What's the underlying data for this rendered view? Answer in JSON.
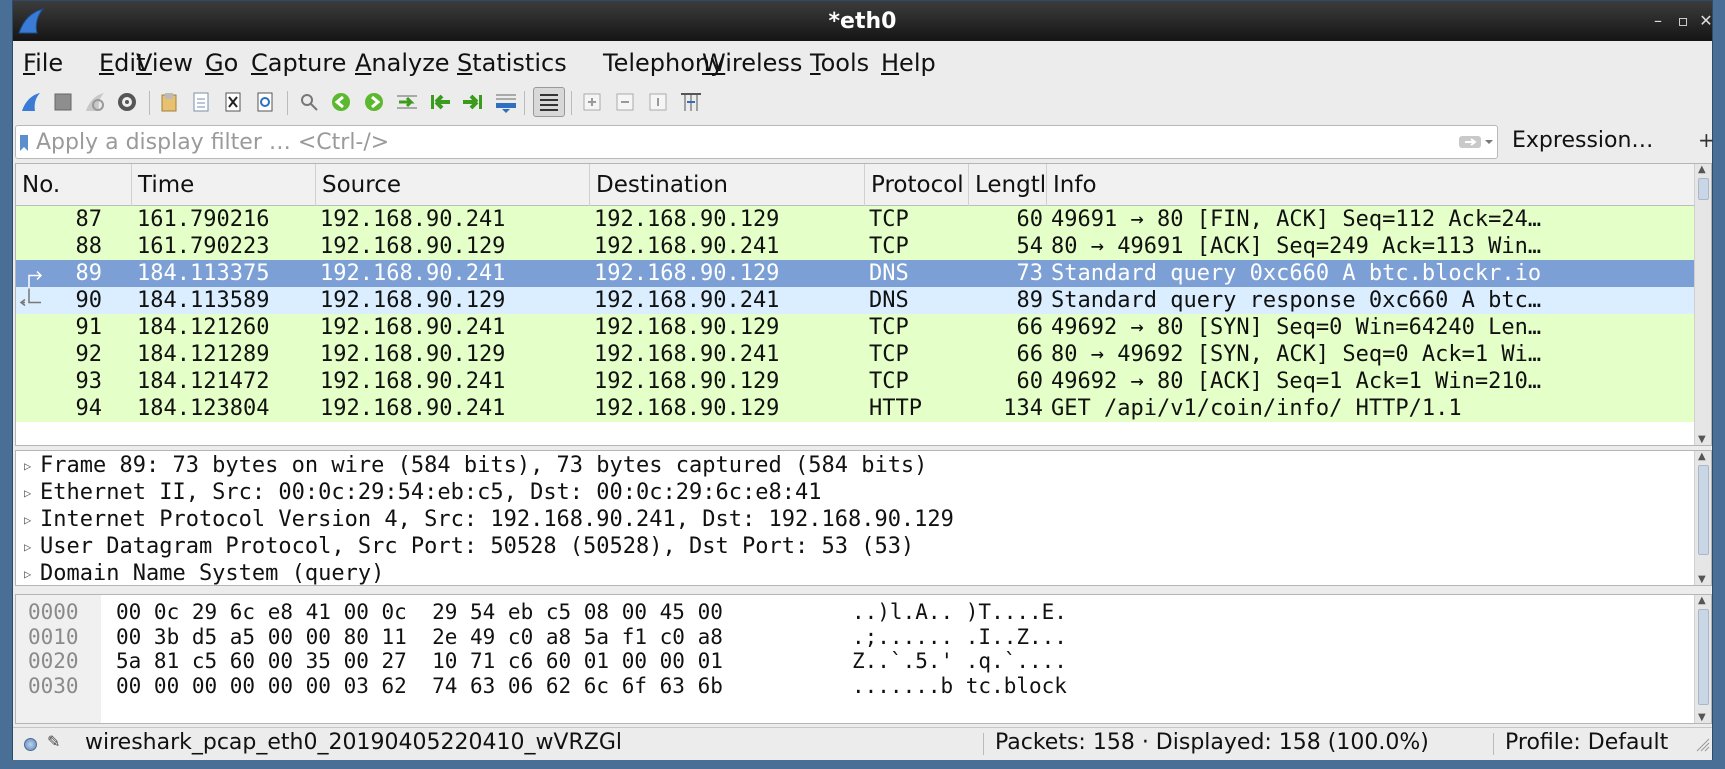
{
  "window": {
    "title": "*eth0",
    "minimize": "–",
    "maximize": "▫",
    "close": "✕"
  },
  "menu": [
    {
      "pre": "",
      "u": "F",
      "post": "ile"
    },
    {
      "pre": "",
      "u": "E",
      "post": "dit"
    },
    {
      "pre": "",
      "u": "V",
      "post": "iew"
    },
    {
      "pre": "",
      "u": "G",
      "post": "o"
    },
    {
      "pre": "",
      "u": "C",
      "post": "apture"
    },
    {
      "pre": "",
      "u": "A",
      "post": "nalyze"
    },
    {
      "pre": "",
      "u": "S",
      "post": "tatistics"
    },
    {
      "pre": "Telephon",
      "u": "y",
      "post": ""
    },
    {
      "pre": "",
      "u": "W",
      "post": "ireless"
    },
    {
      "pre": "",
      "u": "T",
      "post": "ools"
    },
    {
      "pre": "",
      "u": "H",
      "post": "elp"
    }
  ],
  "filter": {
    "placeholder": "Apply a display filter … <Ctrl-/>",
    "value": "",
    "expression_label": "Expression…",
    "add_label": "+"
  },
  "columns": [
    "No.",
    "Time",
    "Source",
    "Destination",
    "Protocol",
    "Lengtl",
    "Info"
  ],
  "colors": {
    "tcp_row": "#e4ffc7",
    "dns_row": "#daeeff",
    "selected_row": "#7ca0d6",
    "accent": "#2e6fc0"
  },
  "packets": [
    {
      "no": "87",
      "time": "161.790216",
      "src": "192.168.90.241",
      "dst": "192.168.90.129",
      "proto": "TCP",
      "len": "60",
      "info": "49691 → 80 [FIN, ACK] Seq=112 Ack=24…",
      "kind": "tcp"
    },
    {
      "no": "88",
      "time": "161.790223",
      "src": "192.168.90.129",
      "dst": "192.168.90.241",
      "proto": "TCP",
      "len": "54",
      "info": "80 → 49691 [ACK] Seq=249 Ack=113 Win…",
      "kind": "tcp"
    },
    {
      "no": "89",
      "time": "184.113375",
      "src": "192.168.90.241",
      "dst": "192.168.90.129",
      "proto": "DNS",
      "len": "73",
      "info": "Standard query 0xc660 A btc.blockr.io",
      "kind": "selected"
    },
    {
      "no": "90",
      "time": "184.113589",
      "src": "192.168.90.129",
      "dst": "192.168.90.241",
      "proto": "DNS",
      "len": "89",
      "info": "Standard query response 0xc660 A btc…",
      "kind": "dns"
    },
    {
      "no": "91",
      "time": "184.121260",
      "src": "192.168.90.241",
      "dst": "192.168.90.129",
      "proto": "TCP",
      "len": "66",
      "info": "49692 → 80 [SYN] Seq=0 Win=64240 Len…",
      "kind": "tcp"
    },
    {
      "no": "92",
      "time": "184.121289",
      "src": "192.168.90.129",
      "dst": "192.168.90.241",
      "proto": "TCP",
      "len": "66",
      "info": "80 → 49692 [SYN, ACK] Seq=0 Ack=1 Wi…",
      "kind": "tcp"
    },
    {
      "no": "93",
      "time": "184.121472",
      "src": "192.168.90.241",
      "dst": "192.168.90.129",
      "proto": "TCP",
      "len": "60",
      "info": "49692 → 80 [ACK] Seq=1 Ack=1 Win=210…",
      "kind": "tcp"
    },
    {
      "no": "94",
      "time": "184.123804",
      "src": "192.168.90.241",
      "dst": "192.168.90.129",
      "proto": "HTTP",
      "len": "134",
      "info": "GET /api/v1/coin/info/ HTTP/1.1",
      "kind": "tcp"
    }
  ],
  "details": [
    "Frame 89: 73 bytes on wire (584 bits), 73 bytes captured (584 bits)",
    "Ethernet II, Src: 00:0c:29:54:eb:c5, Dst: 00:0c:29:6c:e8:41",
    "Internet Protocol Version 4, Src: 192.168.90.241, Dst: 192.168.90.129",
    "User Datagram Protocol, Src Port: 50528 (50528), Dst Port: 53 (53)",
    "Domain Name System (query)"
  ],
  "bytes": [
    {
      "off": "0000",
      "hex": "00 0c 29 6c e8 41 00 0c  29 54 eb c5 08 00 45 00",
      "ascii": "..)l.A.. )T....E."
    },
    {
      "off": "0010",
      "hex": "00 3b d5 a5 00 00 80 11  2e 49 c0 a8 5a f1 c0 a8",
      "ascii": ".;...... .I..Z..."
    },
    {
      "off": "0020",
      "hex": "5a 81 c5 60 00 35 00 27  10 71 c6 60 01 00 00 01",
      "ascii": "Z..`.5.' .q.`...."
    },
    {
      "off": "0030",
      "hex": "00 00 00 00 00 00 03 62  74 63 06 62 6c 6f 63 6b",
      "ascii": ".......b tc.block"
    }
  ],
  "status": {
    "file": "wireshark_pcap_eth0_20190405220410_wVRZGl",
    "packets": "Packets: 158 · Displayed: 158 (100.0%)",
    "profile": "Profile: Default"
  }
}
